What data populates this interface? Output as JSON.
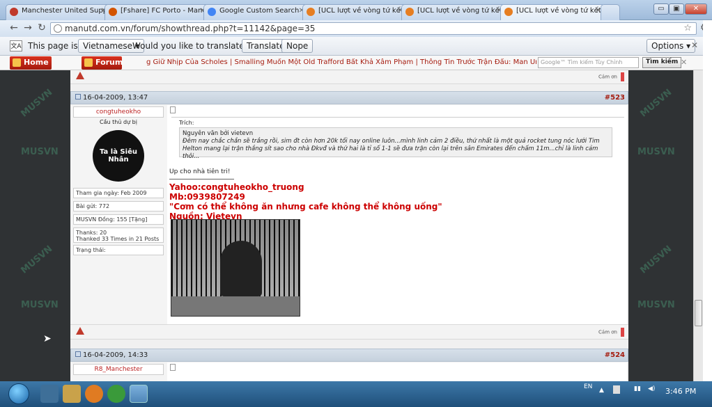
{
  "browser": {
    "tabs": [
      {
        "title": "Manchester United Support",
        "active": false,
        "fav_color": "#c0392b"
      },
      {
        "title": "[Fshare] FC Porto - Manche",
        "active": false,
        "fav_color": "#d35400"
      },
      {
        "title": "Google Custom Search",
        "active": false,
        "fav_color": "#4285f4"
      },
      {
        "title": "[UCL lượt về vòng tứ kết] FC",
        "active": false,
        "fav_color": "#e67e22"
      },
      {
        "title": "[UCL lượt về vòng tứ kết] FC",
        "active": false,
        "fav_color": "#e67e22"
      },
      {
        "title": "[UCL lượt về vòng tứ kết] FC",
        "active": true,
        "fav_color": "#e67e22"
      }
    ],
    "url": "manutd.com.vn/forum/showthread.php?t=11142&page=35",
    "window_controls": {
      "minimize": "▭",
      "maximize": "▣",
      "close": "✕"
    }
  },
  "translate_bar": {
    "prefix": "This page is in",
    "language": "Vietnamese",
    "question": "Would you like to translate it?",
    "translate_btn": "Translate",
    "nope_btn": "Nope",
    "options_btn": "Options"
  },
  "site": {
    "home": "Home",
    "forum": "Forum",
    "marquee": "g Giữ Nhịp Của Scholes  |  Smalling Muốn Một Old Trafford Bất Khả Xâm Phạm  |  Thông Tin Trước Trận Đấu: Man United Vs Fulham  |  Evan",
    "search_placeholder": "Google™ Tìm kiếm Tùy Chỉnh",
    "search_btn": "Tìm kiếm",
    "watermark": "MUSVN"
  },
  "thanks_label": "Cám ơn",
  "posts": [
    {
      "date": "16-04-2009, 13:47",
      "number": "#523",
      "username": "congtuheokho",
      "rank": "Cầu thủ dự bị",
      "avatar_text": "Ta là Siêu Nhân",
      "join": "Tham gia ngày: Feb 2009",
      "posts": "Bài gửi: 772",
      "musvn": "MUSVN Đồng: 155 [Tặng]",
      "thanks1": "Thanks: 20",
      "thanks2": "Thanked 33 Times in 21 Posts",
      "status": "Trạng thái:",
      "quote_label": "Trích:",
      "quote_author": "Nguyên văn bởi vietevn",
      "quote_text": "Đêm nay chắc chắn sẽ trắng rồi, sim đt còn hơn 20k tối nay online luôn...mình linh cảm 2 điều, thứ nhất là một quả rocket tung nóc lưới Tim Helton mang lại trận thắng sít sao cho nhà Đkvđ và thứ hai là tỉ số 1-1 sẽ đưa trận còn lại trên sân Emirates đến chấm 11m...chỉ là linh cảm thôi...",
      "reply": "Up cho nhà tiên tri!",
      "sig": [
        "Yahoo:congtuheokho_truong",
        "Mb:0939807249",
        "\"Cơm có thể không ăn nhưng cafe không thể không uống\"",
        "Nguồn: Vietevn"
      ]
    },
    {
      "date": "16-04-2009, 14:33",
      "number": "#524",
      "username": "R8_Manchester"
    }
  ],
  "taskbar": {
    "lang": "EN",
    "clock": "3:46 PM"
  }
}
